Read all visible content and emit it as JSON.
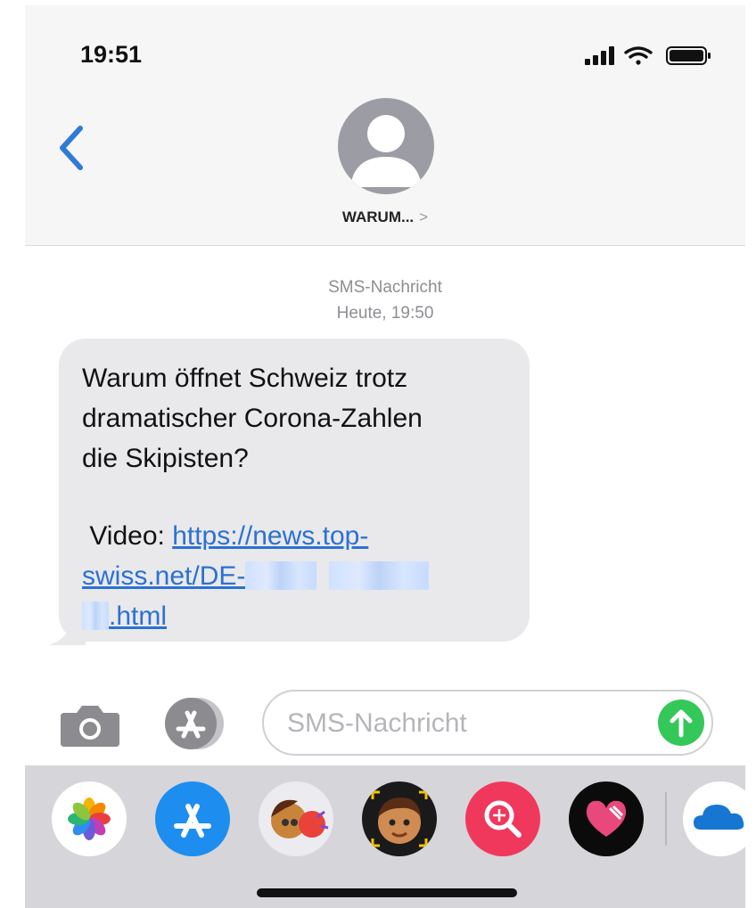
{
  "status_bar": {
    "time": "19:51",
    "icons": [
      "signal-icon",
      "wifi-icon",
      "battery-icon"
    ]
  },
  "header": {
    "back_icon": "chevron-left-icon",
    "contact_name": "WARUM...",
    "contact_chevron": ">"
  },
  "conversation": {
    "meta_type": "SMS-Nachricht",
    "meta_time": "Heute, 19:50",
    "message": {
      "line1": "Warum öffnet Schweiz trotz",
      "line2": "dramatischer Corona-Zahlen",
      "line3": "die Skipisten?",
      "video_prefix": "Video: ",
      "link_part1": "https://news.top-",
      "link_part2": "swiss.net/DE-",
      "link_part3": ".html"
    }
  },
  "input_bar": {
    "placeholder": "SMS-Nachricht"
  },
  "app_drawer": {
    "apps": [
      "photos-icon",
      "app-store-icon",
      "memoji-stickers-icon",
      "animoji-icon",
      "web-search-icon",
      "digital-touch-icon",
      "cloud-icon"
    ]
  },
  "colors": {
    "link": "#2c71d2",
    "back_chevron": "#2f7ad9",
    "send": "#34c759",
    "bubble": "#e9e9eb",
    "app_store": "#1d8df0",
    "search_app": "#f0385c"
  }
}
